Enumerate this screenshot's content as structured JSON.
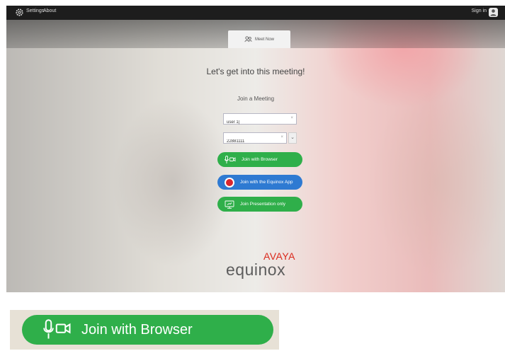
{
  "topbar": {
    "settings": "Settings",
    "about": "About",
    "sign_in": "Sign in"
  },
  "tab": {
    "label": "Meet Now"
  },
  "main": {
    "headline": "Let's get into this meeting!",
    "subheading": "Join a Meeting"
  },
  "form": {
    "name_value": "user 1|",
    "name_clear": "×",
    "meeting_id_value": "22881111",
    "meeting_id_clear": "×",
    "history_dropdown": "⌄"
  },
  "buttons": {
    "join_browser": "Join with Browser",
    "join_app": "Join with the Equinox App",
    "join_presentation": "Join Presentation only"
  },
  "logo": {
    "avaya": "AVAYA",
    "equinox": "equinox"
  },
  "zoom": {
    "join_browser": "Join with Browser"
  },
  "colors": {
    "green": "#2faf4a",
    "blue": "#2e7ad2",
    "brand_red": "#da291c",
    "topbar": "#1d1d1d"
  },
  "icons": {
    "settings": "gear-icon",
    "user": "user-avatar-icon",
    "tab": "meet-now-icon",
    "browser": "mic-camera-icon",
    "app": "equinox-app-icon",
    "presentation": "presentation-screen-icon"
  }
}
